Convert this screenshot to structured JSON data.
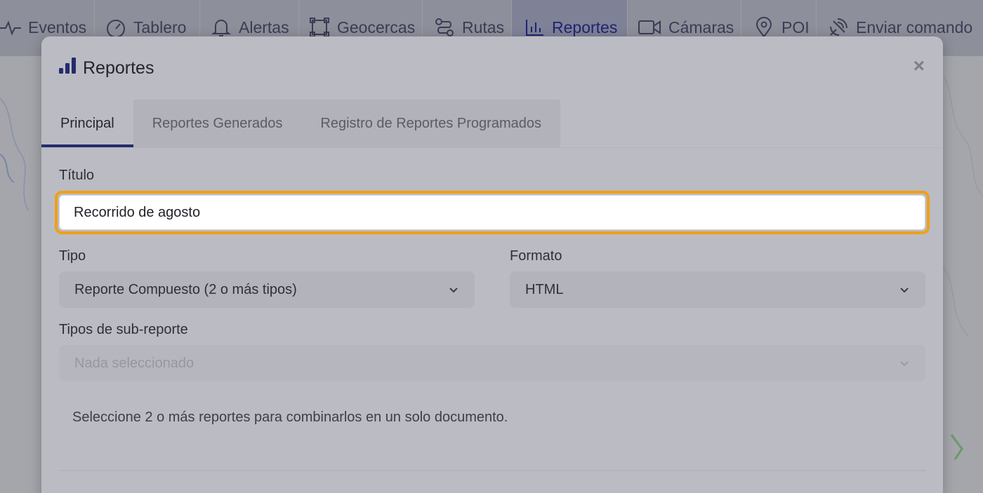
{
  "nav": {
    "items": [
      {
        "label": "Eventos",
        "icon": "pulse-icon"
      },
      {
        "label": "Tablero",
        "icon": "gauge-icon"
      },
      {
        "label": "Alertas",
        "icon": "bell-icon"
      },
      {
        "label": "Geocercas",
        "icon": "geofence-icon"
      },
      {
        "label": "Rutas",
        "icon": "route-icon"
      },
      {
        "label": "Reportes",
        "icon": "bar-chart-icon",
        "active": true
      },
      {
        "label": "Cámaras",
        "icon": "video-camera-icon"
      },
      {
        "label": "POI",
        "icon": "map-pin-icon"
      },
      {
        "label": "Enviar comando",
        "icon": "satellite-icon"
      }
    ]
  },
  "modal": {
    "title": "Reportes",
    "close_label": "×",
    "tabs": [
      {
        "label": "Principal",
        "active": true
      },
      {
        "label": "Reportes Generados"
      },
      {
        "label": "Registro de Reportes Programados"
      }
    ],
    "form": {
      "title_label": "Título",
      "title_value": "Recorrido de agosto",
      "type_label": "Tipo",
      "type_value": "Reporte Compuesto (2 o más tipos)",
      "format_label": "Formato",
      "format_value": "HTML",
      "subreport_label": "Tipos de sub-reporte",
      "subreport_placeholder": "Nada seleccionado",
      "help_text": "Seleccione 2 o más reportes para combinarlos en un solo documento."
    }
  },
  "colors": {
    "accent": "#262b6e",
    "focus_ring": "#f0a016",
    "modal_bg": "#bbbcc3"
  }
}
